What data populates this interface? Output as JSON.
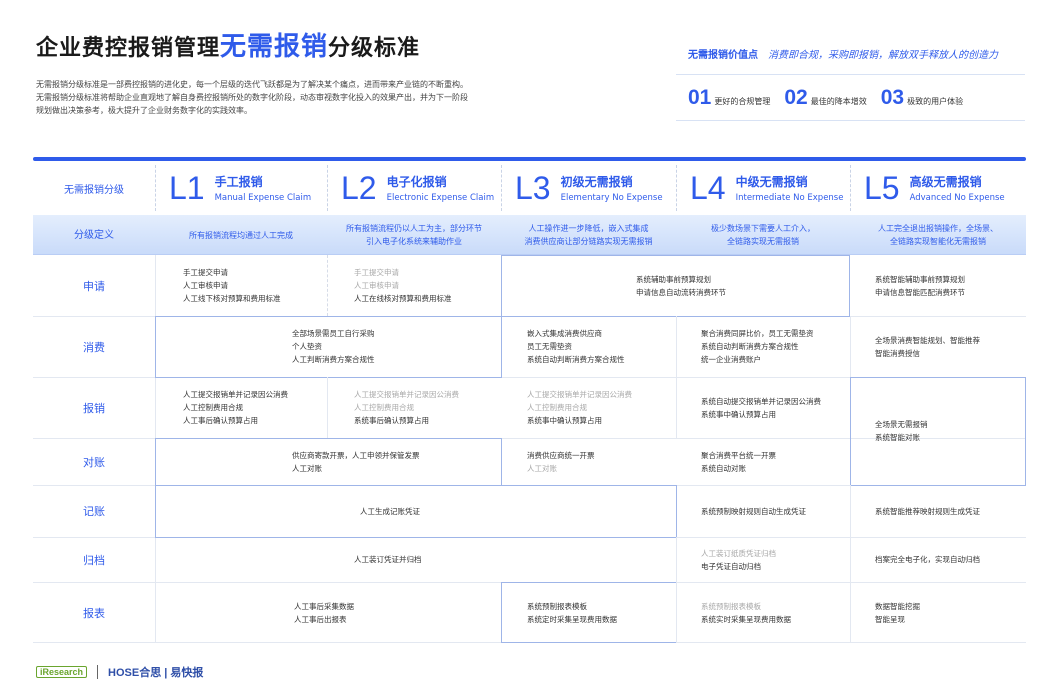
{
  "title": {
    "main": "企业费控报销管理",
    "highlight": "无需报销",
    "suffix": "分级标准"
  },
  "intro": [
    "无需报销分级标准是一部费控报销的进化史，每一个层级的迭代飞跃都是为了解决某个痛点，进而带来产业链的不断重构。",
    "无需报销分级标准将帮助企业直观地了解自身费控报销所处的数字化阶段，动态审视数字化投入的效果产出，并为下一阶段",
    "规划做出决策参考，极大提升了企业财务数字化的实践效率。"
  ],
  "value_points": {
    "lead": "无需报销价值点",
    "slogan": "消费即合规，采购即报销，解放双手释放人的创造力",
    "items": [
      {
        "num": "01",
        "text": "更好的合规管理"
      },
      {
        "num": "02",
        "text": "最佳的降本增效"
      },
      {
        "num": "03",
        "text": "极致的用户体验"
      }
    ]
  },
  "accent_color": "#2f5bea",
  "table": {
    "header_label": "无需报销分级",
    "levels": [
      {
        "code": "L1",
        "cn": "手工报销",
        "en": "Manual Expense Claim"
      },
      {
        "code": "L2",
        "cn": "电子化报销",
        "en": "Electronic Expense Claim"
      },
      {
        "code": "L3",
        "cn": "初级无需报销",
        "en": "Elementary No Expense"
      },
      {
        "code": "L4",
        "cn": "中级无需报销",
        "en": "Intermediate No Expense"
      },
      {
        "code": "L5",
        "cn": "高级无需报销",
        "en": "Advanced No Expense"
      }
    ],
    "definition_label": "分级定义",
    "definitions": [
      {
        "l1": "所有报销流程均通过人工完成",
        "l2": ""
      },
      {
        "l1": "所有报销流程仍以人工为主，部分环节",
        "l2": "引入电子化系统来辅助作业"
      },
      {
        "l1": "人工操作进一步降低，嵌入式集成",
        "l2": "消费供应商让部分链路实现无需报销"
      },
      {
        "l1": "极少数场景下需要人工介入，",
        "l2": "全链路实现无需报销"
      },
      {
        "l1": "人工完全退出报销操作，全场景、",
        "l2": "全链路实现智能化无需报销"
      }
    ],
    "row_labels": [
      "申请",
      "消费",
      "报销",
      "对账",
      "记账",
      "归档",
      "报表"
    ],
    "cells": {
      "apply_l1": [
        "手工提交申请",
        "人工审核申请",
        "人工线下核对预算和费用标准"
      ],
      "apply_l2": [
        "手工提交申请",
        "人工审核申请",
        "人工在线核对预算和费用标准"
      ],
      "apply_l34": [
        "系统辅助事前预算规划",
        "申请信息自动流转消费环节"
      ],
      "apply_l5": [
        "系统智能辅助事前预算规划",
        "申请信息智能匹配消费环节"
      ],
      "consume_l12": [
        "全部场景需员工自行采购",
        "个人垫资",
        "人工判断消费方案合规性"
      ],
      "consume_l3": [
        "嵌入式集成消费供应商",
        "员工无需垫资",
        "系统自动判断消费方案合规性"
      ],
      "consume_l4": [
        "聚合消费同屏比价，员工无需垫资",
        "系统自动判断消费方案合规性",
        "统一企业消费账户"
      ],
      "consume_l5": [
        "全场景消费智能规划、智能推荐",
        "智能消费授信"
      ],
      "claim_l1": [
        "人工提交报销单并记录因公消费",
        "人工控制费用合规",
        "人工事后确认预算占用"
      ],
      "claim_l2": [
        "人工提交报销单并记录因公消费",
        "人工控制费用合规",
        "系统事后确认预算占用"
      ],
      "claim_l3": [
        "人工提交报销单并记录因公消费",
        "人工控制费用合规",
        "系统事中确认预算占用"
      ],
      "claim_l4": [
        "系统自动提交报销单并记录因公消费",
        "系统事中确认预算占用"
      ],
      "reconcile_l12": [
        "供应商寄款开票，人工申领并保管发票",
        "人工对账"
      ],
      "reconcile_l3": [
        "消费供应商统一开票",
        "人工对账"
      ],
      "reconcile_l4": [
        "聚合消费平台统一开票",
        "系统自动对账"
      ],
      "claim_reconcile_l5": [
        "全场景无需报销",
        "系统智能对账"
      ],
      "book_l13": [
        "人工生成记账凭证"
      ],
      "book_l4": [
        "系统预制映射规则自动生成凭证"
      ],
      "book_l5": [
        "系统智能推荐映射规则生成凭证"
      ],
      "archive_l13": [
        "人工装订凭证并归档"
      ],
      "archive_l4": [
        "人工装订纸质凭证归档",
        "电子凭证自动归档"
      ],
      "archive_l5": [
        "档案完全电子化，实现自动归档"
      ],
      "report_l12": [
        "人工事后采集数据",
        "人工事后出报表"
      ],
      "report_l3": [
        "系统预制报表模板",
        "系统定时采集呈现费用数据"
      ],
      "report_l4": [
        "系统预制报表模板",
        "系统实时采集呈现费用数据"
      ],
      "report_l5": [
        "数据智能挖掘",
        "智能呈现"
      ]
    }
  },
  "footer": {
    "brand1": "iResearch",
    "brand2": "HOSE合思 | 易快报"
  }
}
